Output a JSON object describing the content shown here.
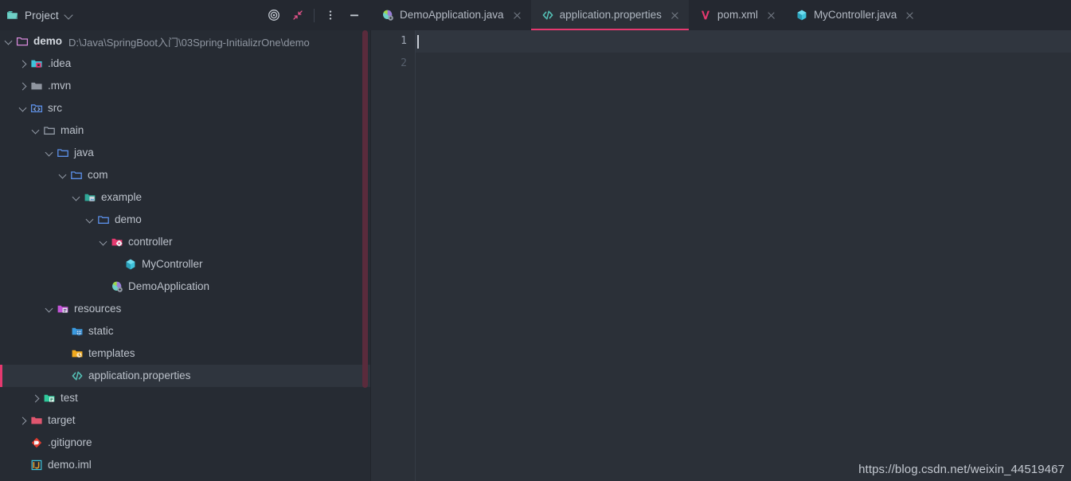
{
  "window": {
    "theme_bg": "#262B33",
    "editor_bg": "#2B3038",
    "accent": "#E5396F"
  },
  "project_panel": {
    "title": "Project",
    "title_icon": "project-folder-icon",
    "dropdown_icon": "chevron-down-icon",
    "toolbar": [
      {
        "name": "scroll-from-source-icon",
        "tooltip": "Select Opened File"
      },
      {
        "name": "collapse-all-icon",
        "tooltip": "Collapse All"
      },
      {
        "name": "options-menu-icon",
        "tooltip": "Options"
      },
      {
        "name": "hide-panel-icon",
        "tooltip": "Hide"
      }
    ]
  },
  "tabs": [
    {
      "label": "DemoApplication.java",
      "icon": "spring-boot-class-icon",
      "active": false,
      "close_icon": "close-icon"
    },
    {
      "label": "application.properties",
      "icon": "properties-file-icon",
      "active": true,
      "close_icon": "close-icon"
    },
    {
      "label": "pom.xml",
      "icon": "maven-file-icon",
      "active": false,
      "close_icon": "close-icon"
    },
    {
      "label": "MyController.java",
      "icon": "java-class-icon",
      "active": false,
      "close_icon": "close-icon"
    }
  ],
  "tree": [
    {
      "label": "demo",
      "path": "D:\\Java\\SpringBoot入门\\03Spring-InitializrOne\\demo",
      "indent": 0,
      "arrow": "down",
      "icon": "module-folder-icon",
      "bold": true,
      "selected": false
    },
    {
      "label": ".idea",
      "path": "",
      "indent": 1,
      "arrow": "right",
      "icon": "idea-folder-icon",
      "bold": false,
      "selected": false
    },
    {
      "label": ".mvn",
      "path": "",
      "indent": 1,
      "arrow": "right",
      "icon": "plain-folder-icon",
      "bold": false,
      "selected": false
    },
    {
      "label": "src",
      "path": "",
      "indent": 1,
      "arrow": "down",
      "icon": "source-root-icon",
      "bold": false,
      "selected": false
    },
    {
      "label": "main",
      "path": "",
      "indent": 2,
      "arrow": "down",
      "icon": "gray-folder-icon",
      "bold": false,
      "selected": false
    },
    {
      "label": "java",
      "path": "",
      "indent": 3,
      "arrow": "down",
      "icon": "blue-folder-icon",
      "bold": false,
      "selected": false
    },
    {
      "label": "com",
      "path": "",
      "indent": 4,
      "arrow": "down",
      "icon": "blue-folder-icon",
      "bold": false,
      "selected": false
    },
    {
      "label": "example",
      "path": "",
      "indent": 5,
      "arrow": "down",
      "icon": "package-folder-icon",
      "bold": false,
      "selected": false
    },
    {
      "label": "demo",
      "path": "",
      "indent": 6,
      "arrow": "down",
      "icon": "blue-folder-icon",
      "bold": false,
      "selected": false
    },
    {
      "label": "controller",
      "path": "",
      "indent": 7,
      "arrow": "down",
      "icon": "controller-folder-icon",
      "bold": false,
      "selected": false
    },
    {
      "label": "MyController",
      "path": "",
      "indent": 8,
      "arrow": "none",
      "icon": "java-class-icon",
      "bold": false,
      "selected": false
    },
    {
      "label": "DemoApplication",
      "path": "",
      "indent": 7,
      "arrow": "none",
      "icon": "spring-boot-class-icon",
      "bold": false,
      "selected": false
    },
    {
      "label": "resources",
      "path": "",
      "indent": 3,
      "arrow": "down",
      "icon": "resources-root-icon",
      "bold": false,
      "selected": false
    },
    {
      "label": "static",
      "path": "",
      "indent": 4,
      "arrow": "none",
      "icon": "static-folder-icon",
      "bold": false,
      "selected": false
    },
    {
      "label": "templates",
      "path": "",
      "indent": 4,
      "arrow": "none",
      "icon": "templates-folder-icon",
      "bold": false,
      "selected": false
    },
    {
      "label": "application.properties",
      "path": "",
      "indent": 4,
      "arrow": "none",
      "icon": "properties-file-icon",
      "bold": false,
      "selected": true
    },
    {
      "label": "test",
      "path": "",
      "indent": 2,
      "arrow": "right",
      "icon": "test-root-icon",
      "bold": false,
      "selected": false
    },
    {
      "label": "target",
      "path": "",
      "indent": 1,
      "arrow": "right",
      "icon": "target-folder-icon",
      "bold": false,
      "selected": false
    },
    {
      "label": ".gitignore",
      "path": "",
      "indent": 2,
      "arrow": "none",
      "icon": "gitignore-file-icon",
      "bold": false,
      "selected": false
    },
    {
      "label": "demo.iml",
      "path": "",
      "indent": 2,
      "arrow": "none",
      "icon": "iml-file-icon",
      "bold": false,
      "selected": false
    }
  ],
  "editor": {
    "line_numbers": [
      "1",
      "2"
    ],
    "current_line": 1,
    "content": ""
  },
  "watermark": "https://blog.csdn.net/weixin_44519467"
}
